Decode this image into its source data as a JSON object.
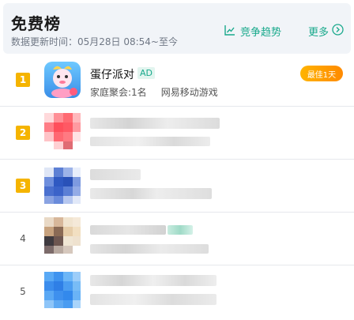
{
  "header": {
    "title": "免费榜",
    "update_text": "数据更新时间：05月28日 08:54~至今",
    "trend_label": "竞争趋势",
    "more_label": "更多"
  },
  "rows": [
    {
      "rank": "1",
      "name": "蛋仔派对",
      "ad_tag": "AD",
      "meta_a": "家庭聚会:1名",
      "meta_b": "网易移动游戏",
      "badge": "最佳1天"
    },
    {
      "rank": "2"
    },
    {
      "rank": "3"
    },
    {
      "rank": "4"
    },
    {
      "rank": "5"
    }
  ],
  "colors": {
    "accent": "#19a98c",
    "rank_badge": "#f5b400",
    "best_badge": "#ff9c00"
  }
}
